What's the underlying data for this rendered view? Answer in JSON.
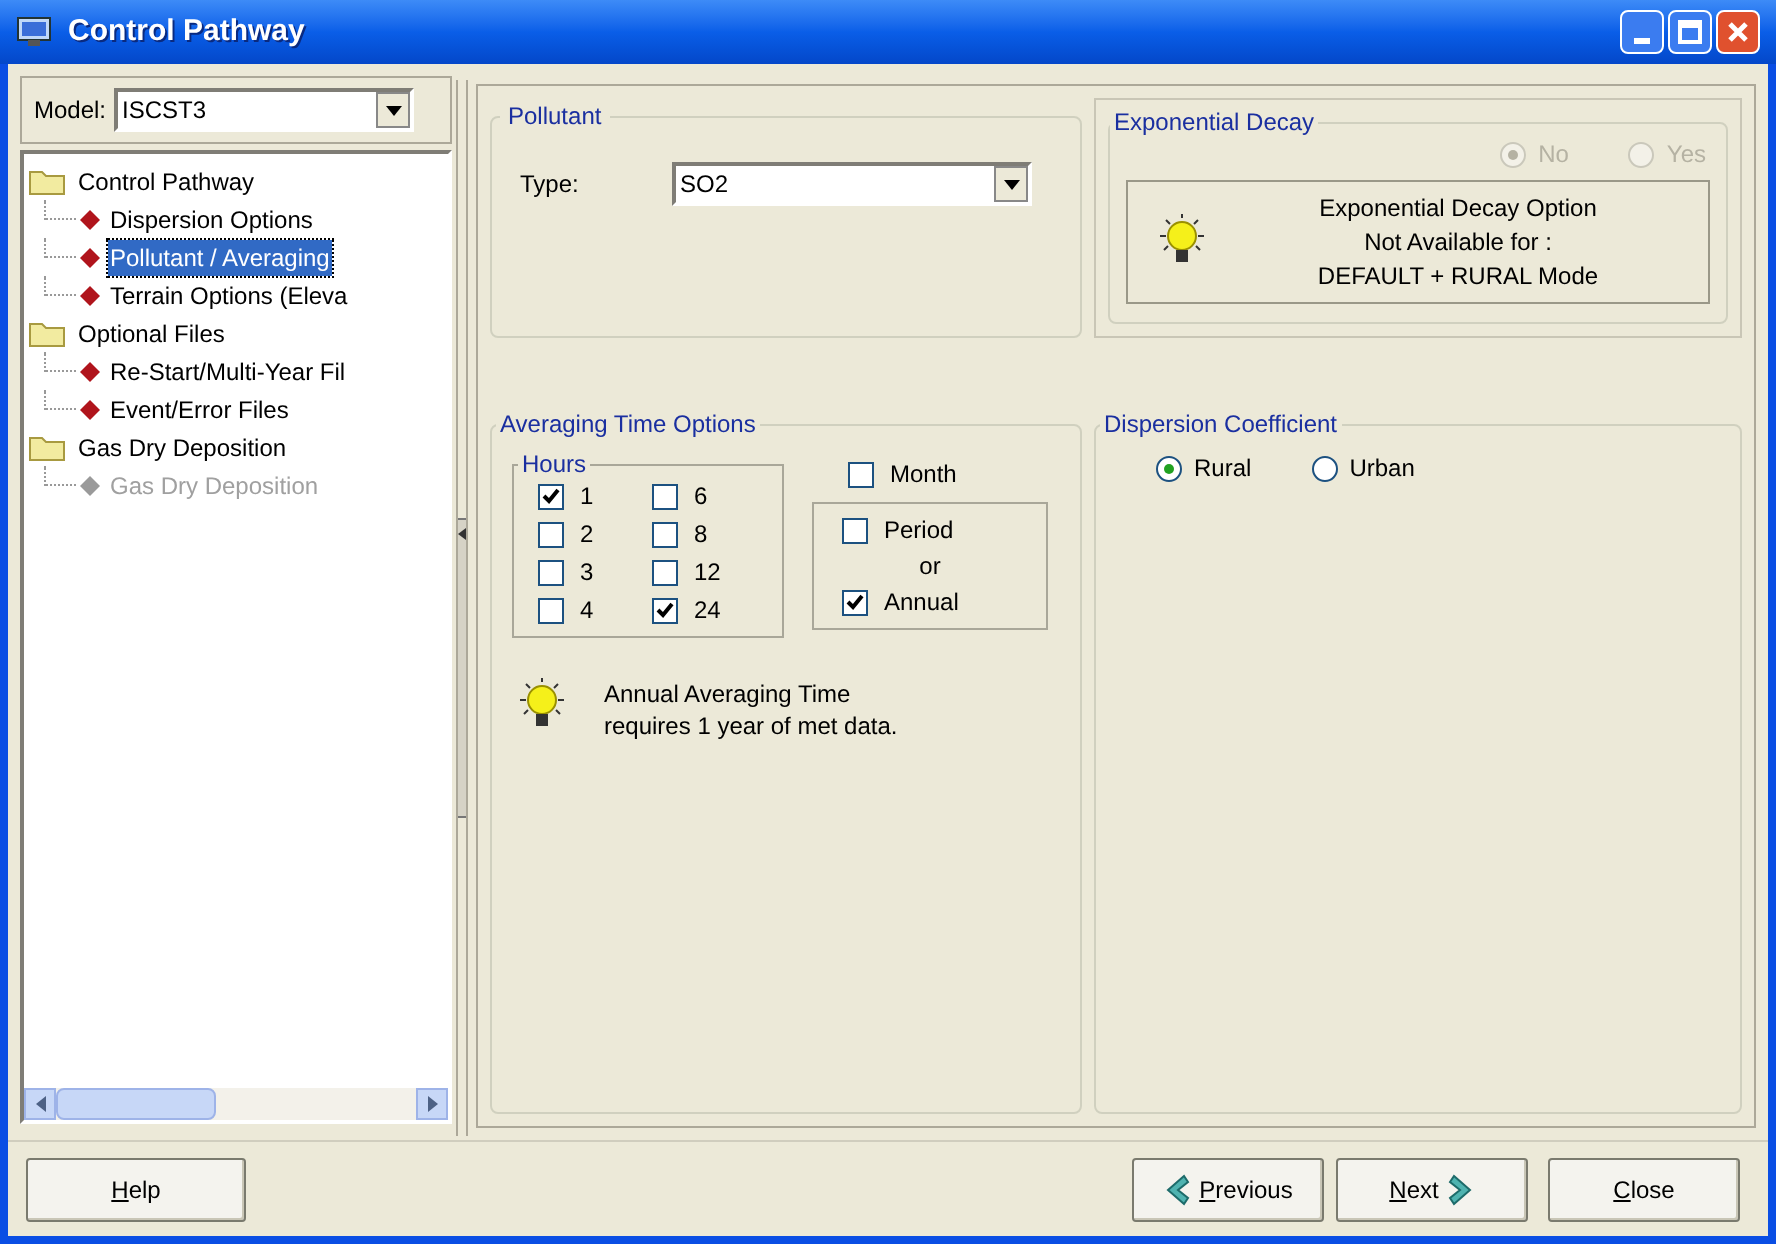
{
  "window": {
    "title": "Control Pathway"
  },
  "model": {
    "label": "Model:",
    "value": "ISCST3"
  },
  "tree": [
    {
      "label": "Control Pathway",
      "kind": "folder",
      "selected": false,
      "disabled": false,
      "children": [
        {
          "label": "Dispersion Options",
          "kind": "leaf",
          "selected": false,
          "disabled": false
        },
        {
          "label": "Pollutant / Averaging",
          "kind": "leaf",
          "selected": true,
          "disabled": false
        },
        {
          "label": "Terrain Options (Eleva",
          "kind": "leaf",
          "selected": false,
          "disabled": false
        }
      ]
    },
    {
      "label": "Optional Files",
      "kind": "folder",
      "selected": false,
      "disabled": false,
      "children": [
        {
          "label": "Re-Start/Multi-Year Fil",
          "kind": "leaf",
          "selected": false,
          "disabled": false
        },
        {
          "label": "Event/Error Files",
          "kind": "leaf",
          "selected": false,
          "disabled": false
        }
      ]
    },
    {
      "label": "Gas Dry Deposition",
      "kind": "folder",
      "selected": false,
      "disabled": false,
      "children": [
        {
          "label": "Gas Dry Deposition",
          "kind": "leaf",
          "selected": false,
          "disabled": true
        }
      ]
    }
  ],
  "pollutant": {
    "title": "Pollutant",
    "type_label": "Type:",
    "type_value": "SO2"
  },
  "exponential_decay": {
    "title": "Exponential Decay",
    "options": [
      {
        "label": "No",
        "selected": true,
        "disabled": true
      },
      {
        "label": "Yes",
        "selected": false,
        "disabled": true
      }
    ],
    "note": [
      "Exponential Decay Option",
      "Not Available for :",
      "DEFAULT + RURAL Mode"
    ]
  },
  "averaging": {
    "title": "Averaging Time Options",
    "hours_title": "Hours",
    "hours": [
      {
        "label": "1",
        "checked": true
      },
      {
        "label": "6",
        "checked": false
      },
      {
        "label": "2",
        "checked": false
      },
      {
        "label": "8",
        "checked": false
      },
      {
        "label": "3",
        "checked": false
      },
      {
        "label": "12",
        "checked": false
      },
      {
        "label": "4",
        "checked": false
      },
      {
        "label": "24",
        "checked": true
      }
    ],
    "month": {
      "label": "Month",
      "checked": false
    },
    "period": {
      "label": "Period",
      "checked": false
    },
    "or_label": "or",
    "annual": {
      "label": "Annual",
      "checked": true
    },
    "note": [
      "Annual Averaging Time",
      "requires 1 year of met data."
    ]
  },
  "dispersion_coefficient": {
    "title": "Dispersion Coefficient",
    "options": [
      {
        "label": "Rural",
        "selected": true
      },
      {
        "label": "Urban",
        "selected": false
      }
    ]
  },
  "buttons": [
    {
      "label": "Help",
      "kind": "plain"
    },
    {
      "label": "Previous",
      "kind": "back"
    },
    {
      "label": "Next",
      "kind": "forward"
    },
    {
      "label": "Close",
      "kind": "plain"
    }
  ]
}
